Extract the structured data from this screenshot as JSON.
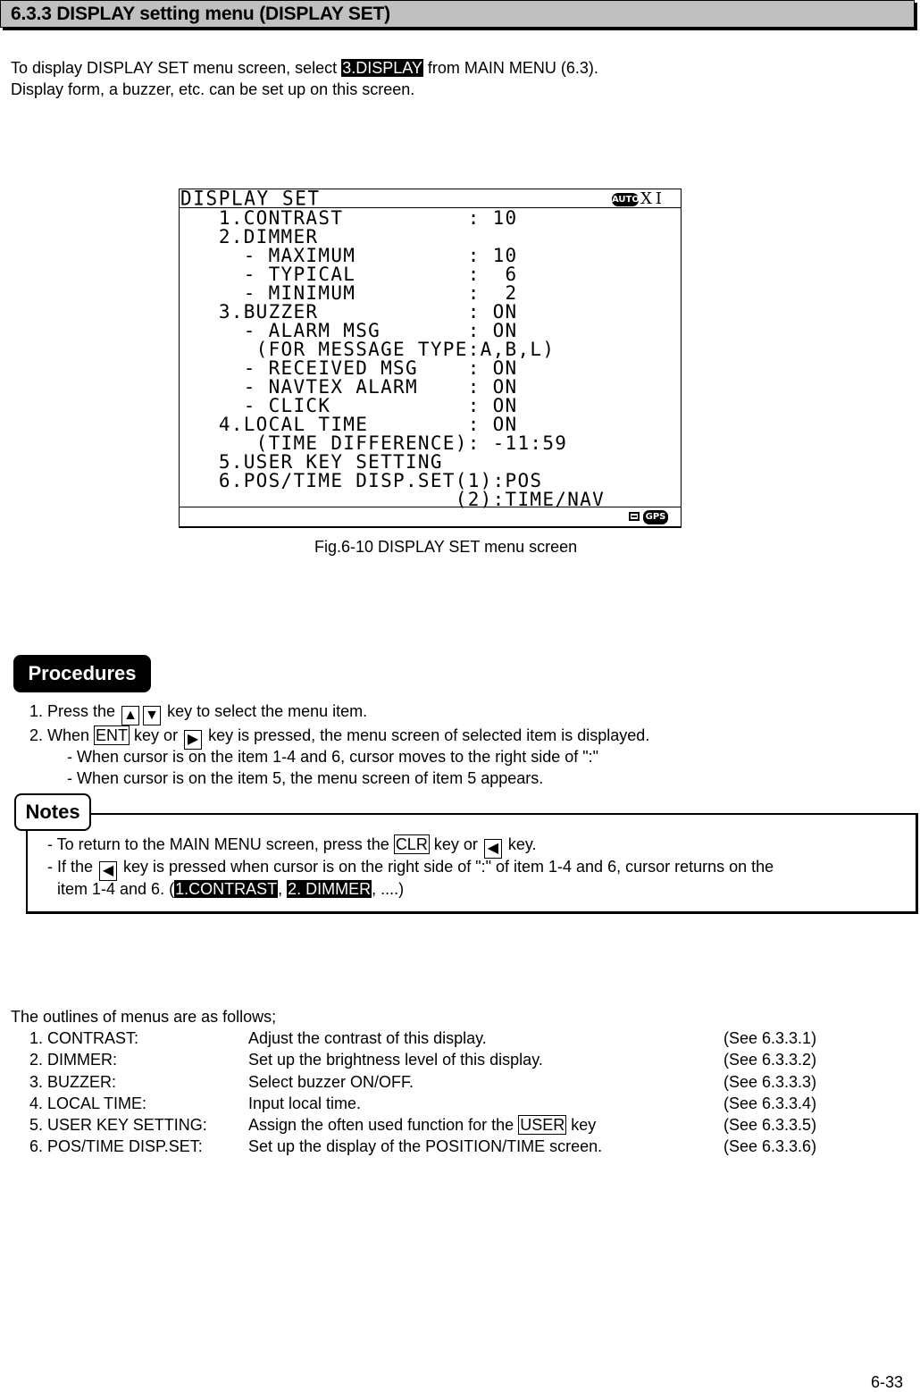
{
  "section": {
    "title": "6.3.3 DISPLAY setting menu (DISPLAY SET)"
  },
  "intro": {
    "line1_before": "To display DISPLAY SET menu screen, select ",
    "line1_highlight": "3.DISPLAY",
    "line1_after": " from MAIN MENU (6.3).",
    "line2": "Display form, a buzzer, etc. can be set up on this screen."
  },
  "lcd": {
    "title": "DISPLAY SET",
    "auto_icon_label": "AUTO",
    "mode_label": "XI",
    "footer_gps_label": "GPS",
    "rows": [
      "   1.CONTRAST          : 10",
      "   2.DIMMER",
      "     - MAXIMUM         : 10",
      "     - TYPICAL         :  6",
      "     - MINIMUM         :  2",
      "   3.BUZZER            : ON",
      "     - ALARM MSG       : ON",
      "      (FOR MESSAGE TYPE:A,B,L)",
      "     - RECEIVED MSG    : ON",
      "     - NAVTEX ALARM    : ON",
      "     - CLICK           : ON",
      "   4.LOCAL TIME        : ON",
      "      (TIME DIFFERENCE): -11:59",
      "   5.USER KEY SETTING",
      "   6.POS/TIME DISP.SET(1):POS",
      "                      (2):TIME/NAV"
    ]
  },
  "figure_caption": "Fig.6-10 DISPLAY SET menu screen",
  "procedures": {
    "badge": "Procedures",
    "step1_before": "1. Press the ",
    "step1_up_key": "▲",
    "step1_down_key": "▼",
    "step1_after": " key to select the menu item.",
    "step2_before": "2. When ",
    "step2_key": "ENT",
    "step2_mid": " key or ",
    "step2_right_key": "▶",
    "step2_after": " key is pressed, the menu screen of selected item is displayed.",
    "sub1": "- When cursor is on the item 1-4 and 6, cursor moves to the right side of \":\"",
    "sub2": "- When cursor is on the item 5, the menu screen of item 5 appears."
  },
  "notes": {
    "badge": "Notes",
    "note1_before": "- To return to the MAIN MENU screen, press the ",
    "note1_key": "CLR",
    "note1_mid": " key or ",
    "note1_left_key": "◀",
    "note1_after": " key.",
    "note2_before": "- If the ",
    "note2_left_key": "◀",
    "note2_after": " key is pressed when cursor is on the right side of \":\" of item 1-4 and 6, cursor returns on the",
    "note3_before": "item 1-4 and 6. (",
    "note3_hl1": "1.CONTRAST",
    "note3_sep": ", ",
    "note3_hl2": "2. DIMMER",
    "note3_after": ", ....)"
  },
  "outlines": {
    "heading": "The outlines of menus are as follows;",
    "items": [
      {
        "name": "1. CONTRAST:",
        "desc": "Adjust the contrast of this display.",
        "ref": "(See 6.3.3.1)"
      },
      {
        "name": "2. DIMMER:",
        "desc": "Set up the brightness level of this display.",
        "ref": "(See 6.3.3.2)"
      },
      {
        "name": "3. BUZZER:",
        "desc": "Select buzzer ON/OFF.",
        "ref": "(See 6.3.3.3)"
      },
      {
        "name": "4. LOCAL TIME:",
        "desc": "Input local time.",
        "ref": "(See 6.3.3.4)"
      },
      {
        "name": "5. USER KEY SETTING:",
        "desc_before": "Assign the often used function for the ",
        "desc_key": "USER",
        "desc_after": " key",
        "ref": "(See 6.3.3.5)"
      },
      {
        "name": "6. POS/TIME DISP.SET:",
        "desc": "Set up the display of the POSITION/TIME screen.",
        "ref": "(See 6.3.3.6)"
      }
    ]
  },
  "page_number": "6-33"
}
